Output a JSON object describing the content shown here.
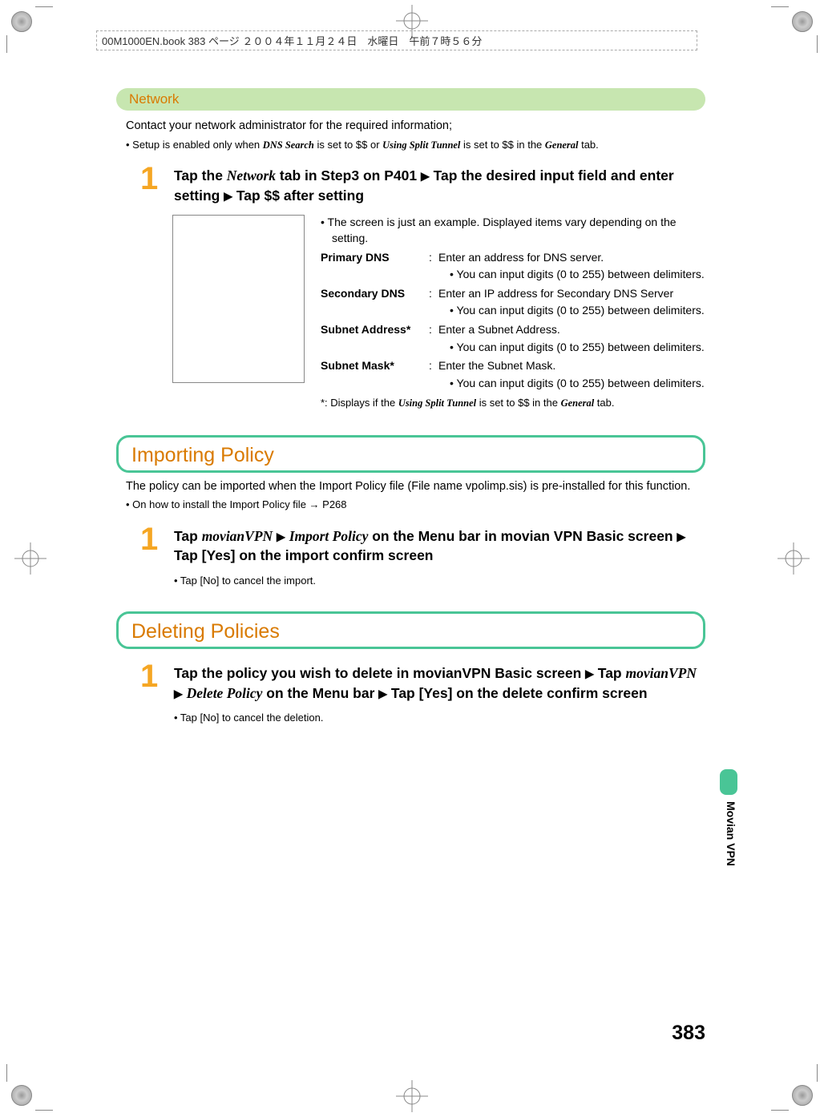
{
  "meta_header": "00M1000EN.book  383 ページ  ２００４年１１月２４日　水曜日　午前７時５６分",
  "network": {
    "title": "Network",
    "intro": "Contact your network administrator for the required information;",
    "bullet": "•  Setup is enabled only when DNS Search is set to $$ or Using Split Tunnel is set to $$ in the General tab.",
    "bullet_prefix": "•  Setup is enabled only when ",
    "bullet_dns": "DNS Search",
    "bullet_mid1": " is set to $$ or ",
    "bullet_ust": "Using Split Tunnel",
    "bullet_mid2": " is set to $$ in the ",
    "bullet_gen": "General",
    "bullet_end": " tab.",
    "step1_a": "Tap the ",
    "step1_b": "Network",
    "step1_c": " tab in Step3 on P401 ",
    "step1_d": " Tap the desired input field and enter setting ",
    "step1_e": " Tap $$ after setting",
    "detail_note": "•  The screen is just an example. Displayed items vary depending on the setting.",
    "primary_dns_label": "Primary DNS",
    "primary_dns_text": "Enter an address for DNS server.",
    "primary_dns_sub": "•  You can input digits (0 to 255) between delimiters.",
    "secondary_dns_label": "Secondary DNS",
    "secondary_dns_text": "Enter an IP address for Secondary DNS Server",
    "secondary_dns_sub": "•  You can input digits (0 to 255) between delimiters.",
    "subnet_addr_label": "Subnet Address*",
    "subnet_addr_text": "Enter a Subnet Address.",
    "subnet_addr_sub": "•  You can input digits (0 to 255) between delimiters.",
    "subnet_mask_label": "Subnet Mask*",
    "subnet_mask_text": "Enter the Subnet Mask.",
    "subnet_mask_sub": "•  You can input digits (0 to 255) between delimiters.",
    "footnote_prefix": "*:   Displays if the ",
    "footnote_ust": "Using Split Tunnel",
    "footnote_mid": " is set to $$ in the ",
    "footnote_gen": "General",
    "footnote_end": " tab."
  },
  "importing": {
    "title": "Importing Policy",
    "intro": "The policy can be imported when the Import Policy file (File name vpolimp.sis) is pre-installed for this function.",
    "bullet": "•  On how to install the Import Policy file → P268",
    "step1_a": "Tap ",
    "step1_b": "movianVPN",
    "step1_c": " ",
    "step1_d": "Import Policy",
    "step1_e": " on the Menu bar in movian VPN Basic screen ",
    "step1_f": " Tap [Yes] on the import confirm screen",
    "sub": "•  Tap [No] to cancel the import."
  },
  "deleting": {
    "title": "Deleting Policies",
    "step1_a": "Tap the policy you wish to delete in movianVPN Basic screen ",
    "step1_b": " Tap ",
    "step1_c": "movianVPN",
    "step1_d": " ",
    "step1_e": "Delete Policy",
    "step1_f": " on the Menu bar ",
    "step1_g": " Tap [Yes] on the delete confirm screen",
    "sub": "•  Tap [No] to cancel the deletion."
  },
  "sidebar_label": "Movian VPN",
  "page_number": "383"
}
